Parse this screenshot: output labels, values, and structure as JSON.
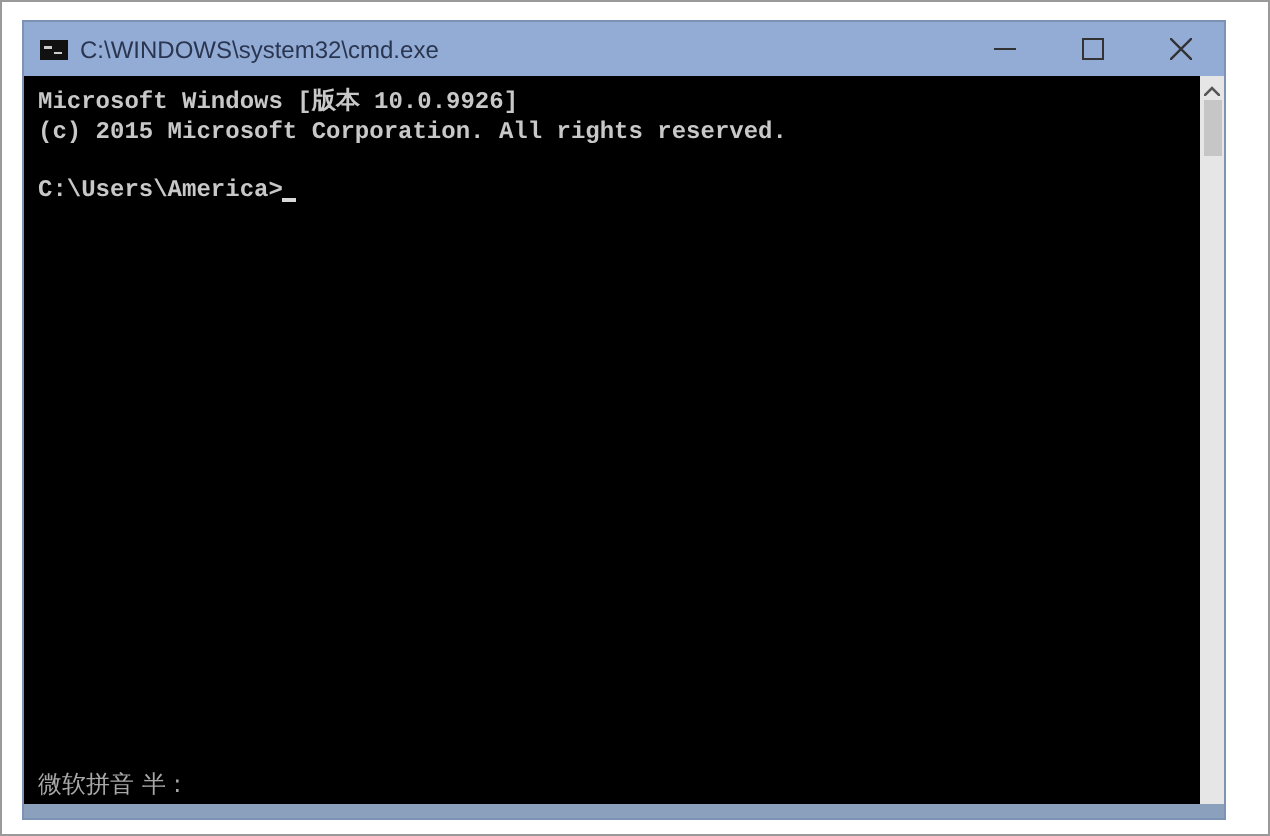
{
  "window": {
    "title": "C:\\WINDOWS\\system32\\cmd.exe"
  },
  "console": {
    "output": [
      "Microsoft Windows [版本 10.0.9926]",
      "(c) 2015 Microsoft Corporation. All rights reserved."
    ],
    "prompt": "C:\\Users\\America>",
    "cursor_visible": true,
    "ime_status": "微软拼音 半 :"
  }
}
